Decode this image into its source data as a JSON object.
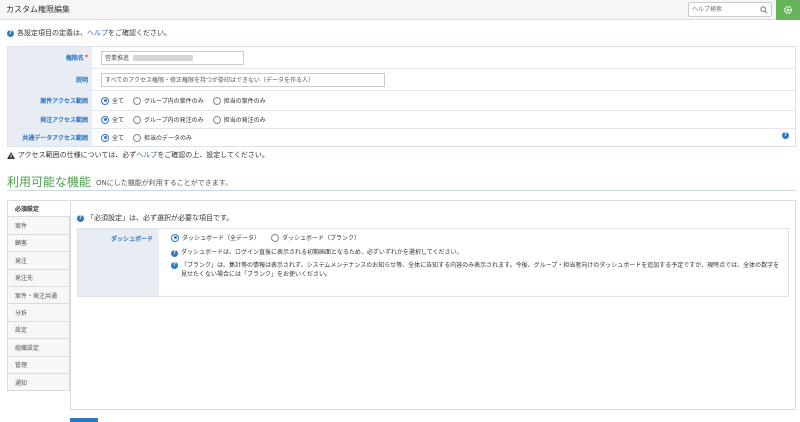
{
  "header": {
    "title": "カスタム権限編集",
    "help_search_placeholder": "ヘルプ検索"
  },
  "info": {
    "prefix": "各設定項目の定義は、",
    "link": "ヘルプ",
    "suffix": "をご確認ください。"
  },
  "settings": {
    "name": {
      "label": "権限名",
      "required_mark": "*",
      "value": "営業推進"
    },
    "description": {
      "label": "説明",
      "value": "すべてのアクセス権限・修正権限を持つが掛印はできない（データを作る人）"
    },
    "case_access": {
      "label": "案件アクセス範囲",
      "options": [
        "全て",
        "グループ内の案件のみ",
        "担当の案件のみ"
      ],
      "selected": 0
    },
    "order_access": {
      "label": "発注アクセス範囲",
      "options": [
        "全て",
        "グループ内の発注のみ",
        "担当の発注のみ"
      ],
      "selected": 0
    },
    "shared_access": {
      "label": "共通データアクセス範囲",
      "options": [
        "全て",
        "担当のデータのみ"
      ],
      "selected": 0
    }
  },
  "warning": {
    "prefix": "アクセス範囲の仕様については、必ず",
    "link": "ヘルプ",
    "suffix": "をご確認の上、設定してください。"
  },
  "section": {
    "title": "利用可能な機能",
    "subtitle": "ONにした機能が利用することができます。"
  },
  "tabs": [
    "必須設定",
    "案件",
    "顧客",
    "発注",
    "発注先",
    "案件・発注共通",
    "分析",
    "設定",
    "組織設定",
    "管理",
    "通知"
  ],
  "active_tab": 0,
  "panel": {
    "note": "「必須設定」は、必ず選択が必要な項目です。",
    "dashboard": {
      "label": "ダッシュボード",
      "options": [
        "ダッシュボード（全データ）",
        "ダッシュボード（ブランク）"
      ],
      "selected": 0,
      "help1": "ダッシュボードは、ログイン直後に表示される初期画面となるため、必ずいずれかを選択してください。",
      "help2": "「ブランク」は、集計等の情報は表示されず、システムメンテナンスのお知らせ等、全体に告知する内容のみ表示されます。今後、グループ・担当者向けのダッシュボードを追加する予定ですが、現時点では、全体の数字を見せたくない場合には「ブランク」をお使いください。"
    }
  },
  "colors": {
    "accent_blue": "#2f78c4",
    "label_bg": "#e7edf3",
    "section_green": "#4aa04a",
    "gear_green": "#67b45a"
  }
}
